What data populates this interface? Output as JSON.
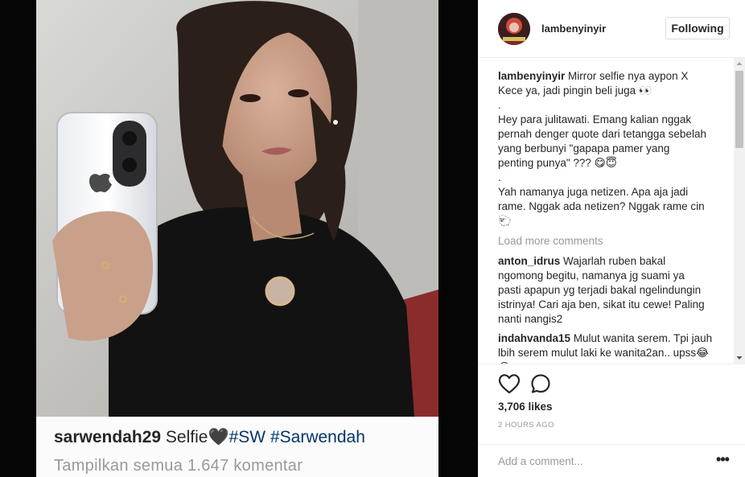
{
  "post": {
    "embedded_caption": {
      "username": "sarwendah29",
      "text": " Selfie",
      "emoji": "🖤",
      "tag1": "#SW",
      "tag2": "#Sarwendah",
      "view_all": "Tampilkan semua 1.647 komentar"
    }
  },
  "header": {
    "username": "lambenyinyir",
    "follow_label": "Following"
  },
  "caption": {
    "username": "lambenyinyir",
    "lines": [
      "Mirror selfie nya aypon X",
      "Kece ya, jadi pingin beli juga 👀",
      ".",
      "Hey para julitawati. Emang kalian nggak",
      "pernah denger quote dari tetangga sebelah",
      "yang berbunyi \"gapapa pamer yang",
      "penting punya\" ??? 😋😇",
      ".",
      "Yah namanya juga netizen. Apa aja jadi",
      "rame. Nggak ada netizen? Nggak rame cin",
      "🐑"
    ]
  },
  "load_more": "Load more comments",
  "comments": [
    {
      "username": "anton_idrus",
      "lines": [
        "Wajarlah ruben bakal",
        "ngomong begitu, namanya jg suami ya",
        "pasti apapun yg terjadi bakal ngelindungin",
        "istrinya! Cari aja ben, sikat itu cewe! Paling",
        "nanti nangis2"
      ]
    },
    {
      "username": "indahvanda15",
      "lines": [
        "Mulut wanita serem. Tpi jauh",
        "lbih serem mulut laki ke wanita2an.. upss😂",
        "😂"
      ]
    }
  ],
  "likes": "3,706 likes",
  "timestamp": "2 HOURS AGO",
  "add_comment_placeholder": "Add a comment...",
  "more_label": "•••",
  "icons": {
    "like": "heart-outline-icon",
    "comment": "speech-bubble-icon",
    "more": "more-options-icon"
  },
  "colors": {
    "link": "#003569",
    "muted": "#999999",
    "border": "#efefef"
  }
}
